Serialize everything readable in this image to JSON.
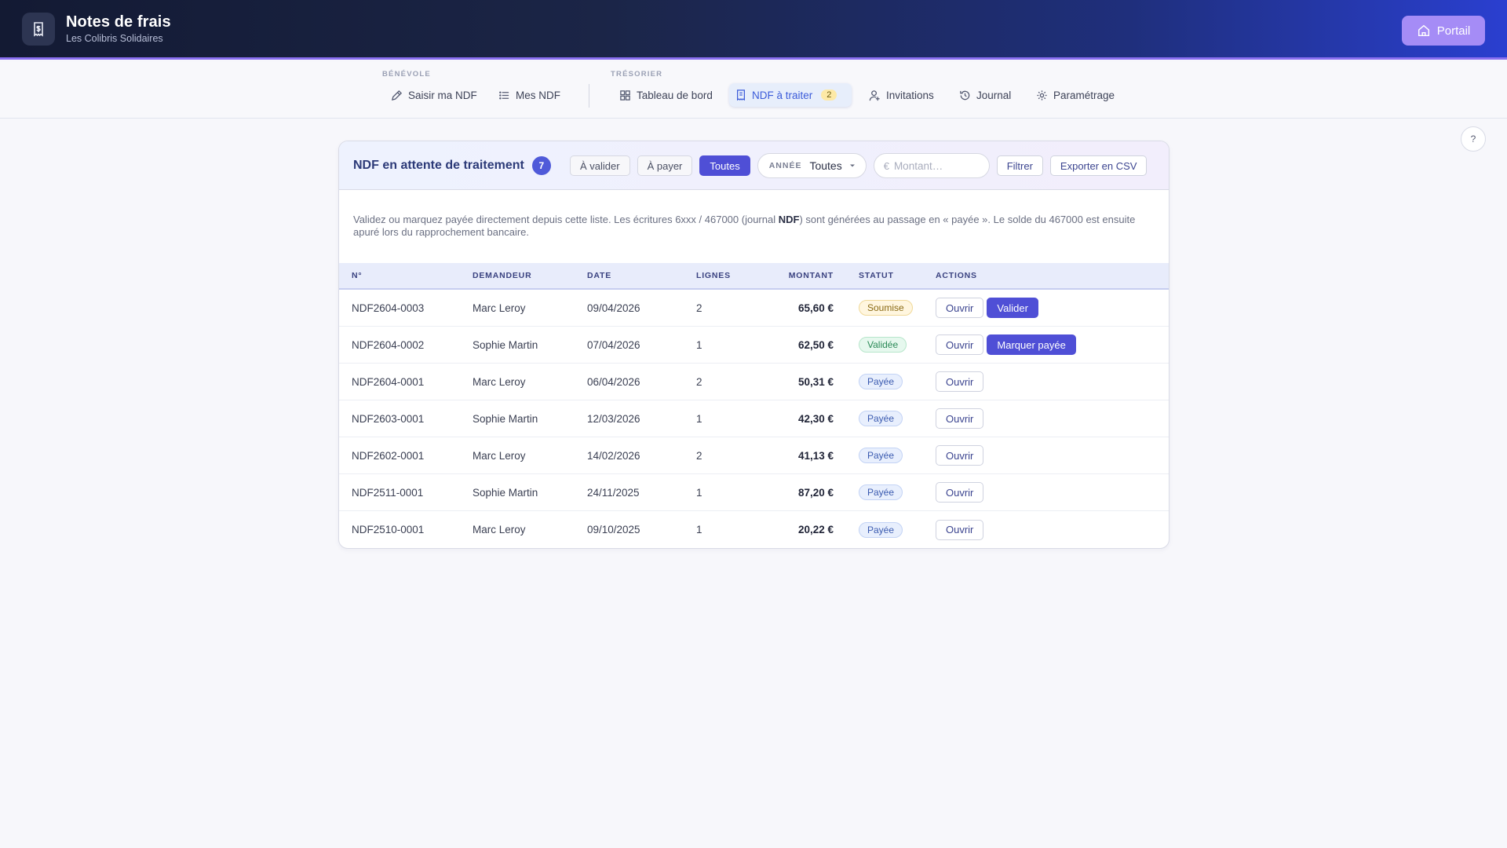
{
  "header": {
    "title": "Notes de frais",
    "subtitle": "Les Colibris Solidaires",
    "portal_label": "Portail"
  },
  "nav": {
    "groups": [
      {
        "label": "BÉNÉVOLE"
      },
      {
        "label": "TRÉSORIER"
      }
    ],
    "items": [
      {
        "label": "Saisir ma NDF",
        "icon": "pen-icon"
      },
      {
        "label": "Mes NDF",
        "icon": "list-icon"
      },
      {
        "label": "Tableau de bord",
        "icon": "grid-icon"
      },
      {
        "label": "NDF à traiter",
        "icon": "receipt-icon",
        "badge": "2",
        "active": true
      },
      {
        "label": "Invitations",
        "icon": "user-plus-icon"
      },
      {
        "label": "Journal",
        "icon": "history-icon"
      },
      {
        "label": "Paramétrage",
        "icon": "gear-icon"
      }
    ]
  },
  "help_label": "?",
  "panel": {
    "title": "NDF en attente de traitement",
    "count": "7",
    "filters": {
      "chips": [
        "À valider",
        "À payer",
        "Toutes"
      ],
      "active_chip": "Toutes",
      "year_label": "ANNÉE",
      "year_value": "Toutes",
      "amount_placeholder": "Montant…",
      "amount_prefix": "€",
      "filter_label": "Filtrer",
      "export_label": "Exporter en CSV"
    },
    "info_pre": "Validez ou marquez payée directement depuis cette liste. Les écritures 6xxx / 467000 (journal ",
    "info_bold": "NDF",
    "info_post": ") sont générées au passage en « payée ». Le solde du 467000 est ensuite apuré lors du rapprochement bancaire."
  },
  "table": {
    "columns": [
      "N°",
      "DEMANDEUR",
      "DATE",
      "LIGNES",
      "MONTANT",
      "STATUT",
      "ACTIONS"
    ],
    "open_label": "Ouvrir",
    "rows": [
      {
        "num": "NDF2604-0003",
        "requester": "Marc Leroy",
        "date": "09/04/2026",
        "lines": "2",
        "amount": "65,60 €",
        "status": "Soumise",
        "status_kind": "soumise",
        "action": "Valider"
      },
      {
        "num": "NDF2604-0002",
        "requester": "Sophie Martin",
        "date": "07/04/2026",
        "lines": "1",
        "amount": "62,50 €",
        "status": "Validée",
        "status_kind": "validee",
        "action": "Marquer payée"
      },
      {
        "num": "NDF2604-0001",
        "requester": "Marc Leroy",
        "date": "06/04/2026",
        "lines": "2",
        "amount": "50,31 €",
        "status": "Payée",
        "status_kind": "payee",
        "action": ""
      },
      {
        "num": "NDF2603-0001",
        "requester": "Sophie Martin",
        "date": "12/03/2026",
        "lines": "1",
        "amount": "42,30 €",
        "status": "Payée",
        "status_kind": "payee",
        "action": ""
      },
      {
        "num": "NDF2602-0001",
        "requester": "Marc Leroy",
        "date": "14/02/2026",
        "lines": "2",
        "amount": "41,13 €",
        "status": "Payée",
        "status_kind": "payee",
        "action": ""
      },
      {
        "num": "NDF2511-0001",
        "requester": "Sophie Martin",
        "date": "24/11/2025",
        "lines": "1",
        "amount": "87,20 €",
        "status": "Payée",
        "status_kind": "payee",
        "action": ""
      },
      {
        "num": "NDF2510-0001",
        "requester": "Marc Leroy",
        "date": "09/10/2025",
        "lines": "1",
        "amount": "20,22 €",
        "status": "Payée",
        "status_kind": "payee",
        "action": ""
      }
    ]
  }
}
